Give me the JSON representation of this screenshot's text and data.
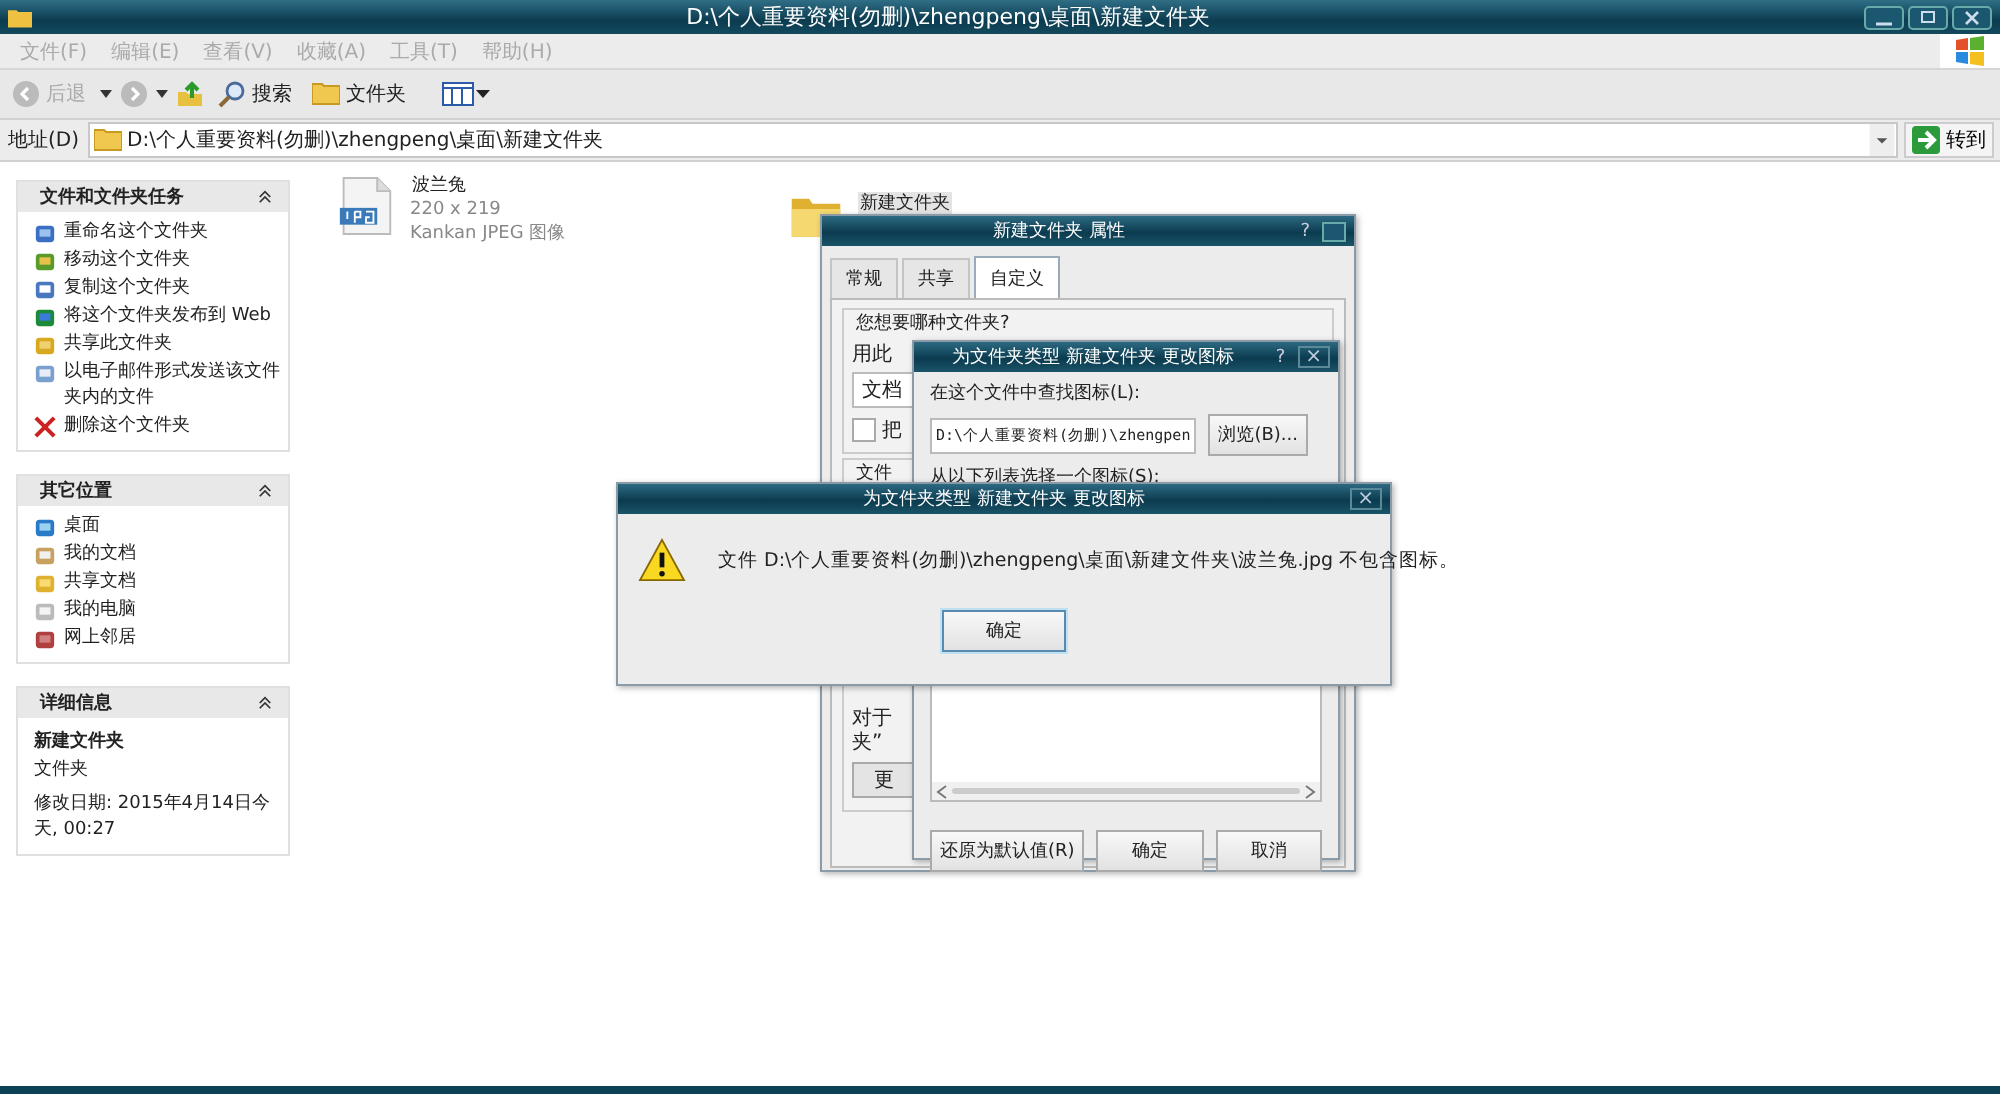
{
  "window": {
    "title": "D:\\个人重要资料(勿删)\\zhengpeng\\桌面\\新建文件夹"
  },
  "menu": [
    {
      "label": "文件(F)",
      "disabled": true
    },
    {
      "label": "编辑(E)",
      "disabled": true
    },
    {
      "label": "查看(V)",
      "disabled": true
    },
    {
      "label": "收藏(A)",
      "disabled": true
    },
    {
      "label": "工具(T)",
      "disabled": true
    },
    {
      "label": "帮助(H)",
      "disabled": true
    }
  ],
  "toolbar": {
    "back": {
      "label": "后退",
      "disabled": true
    },
    "search": "搜索",
    "folders": "文件夹"
  },
  "address": {
    "label": "地址(D)",
    "value": "D:\\个人重要资料(勿删)\\zhengpeng\\桌面\\新建文件夹",
    "go": "转到"
  },
  "task_panels": [
    {
      "kind": "links",
      "title": "文件和文件夹任务",
      "expanded": true,
      "items": [
        "重命名这个文件夹",
        "移动这个文件夹",
        "复制这个文件夹",
        "将这个文件夹发布到 Web",
        "共享此文件夹",
        "以电子邮件形式发送该文件夹内的文件",
        "删除这个文件夹"
      ]
    },
    {
      "kind": "links",
      "title": "其它位置",
      "expanded": true,
      "items": [
        "桌面",
        "我的文档",
        "共享文档",
        "我的电脑",
        "网上邻居"
      ]
    },
    {
      "kind": "details",
      "title": "详细信息",
      "expanded": true,
      "name": "新建文件夹",
      "type": "文件夹",
      "modified": "修改日期: 2015年4月14日今天, 00:27"
    }
  ],
  "files": [
    {
      "kind": "image",
      "name": "波兰兔",
      "dimensions": "220 x 219",
      "type": "Kankan JPEG 图像",
      "selected": false
    },
    {
      "kind": "folder",
      "name": "新建文件夹",
      "selected": true
    }
  ],
  "properties_dialog": {
    "title": "新建文件夹 属性",
    "help": "?",
    "tabs": [
      {
        "label": "常规",
        "selected": false
      },
      {
        "label": "共享",
        "selected": false
      },
      {
        "label": "自定义",
        "selected": true
      }
    ],
    "group_title": "您想要哪种文件夹?",
    "use_label": "用此",
    "template_value": "文档",
    "checkbox_label": "把",
    "checked": false,
    "group2_title": "文件",
    "note_lines": [
      "对于",
      "夹”"
    ],
    "change_button": "更"
  },
  "change_icon_dialog": {
    "title": "为文件夹类型 新建文件夹 更改图标",
    "help": "?",
    "close": "×",
    "find_label": "在这个文件中查找图标(L):",
    "path": "D:\\个人重要资料(勿删)\\zhengpen",
    "browse": "浏览(B)...",
    "list_label": "从以下列表选择一个图标(S):",
    "buttons": [
      "还原为默认值(R)",
      "确定",
      "取消"
    ]
  },
  "error_dialog": {
    "title": "为文件夹类型 新建文件夹 更改图标",
    "close": "×",
    "message": "文件 D:\\个人重要资料(勿删)\\zhengpeng\\桌面\\新建文件夹\\波兰兔.jpg 不包含图标。",
    "button": "确定"
  }
}
